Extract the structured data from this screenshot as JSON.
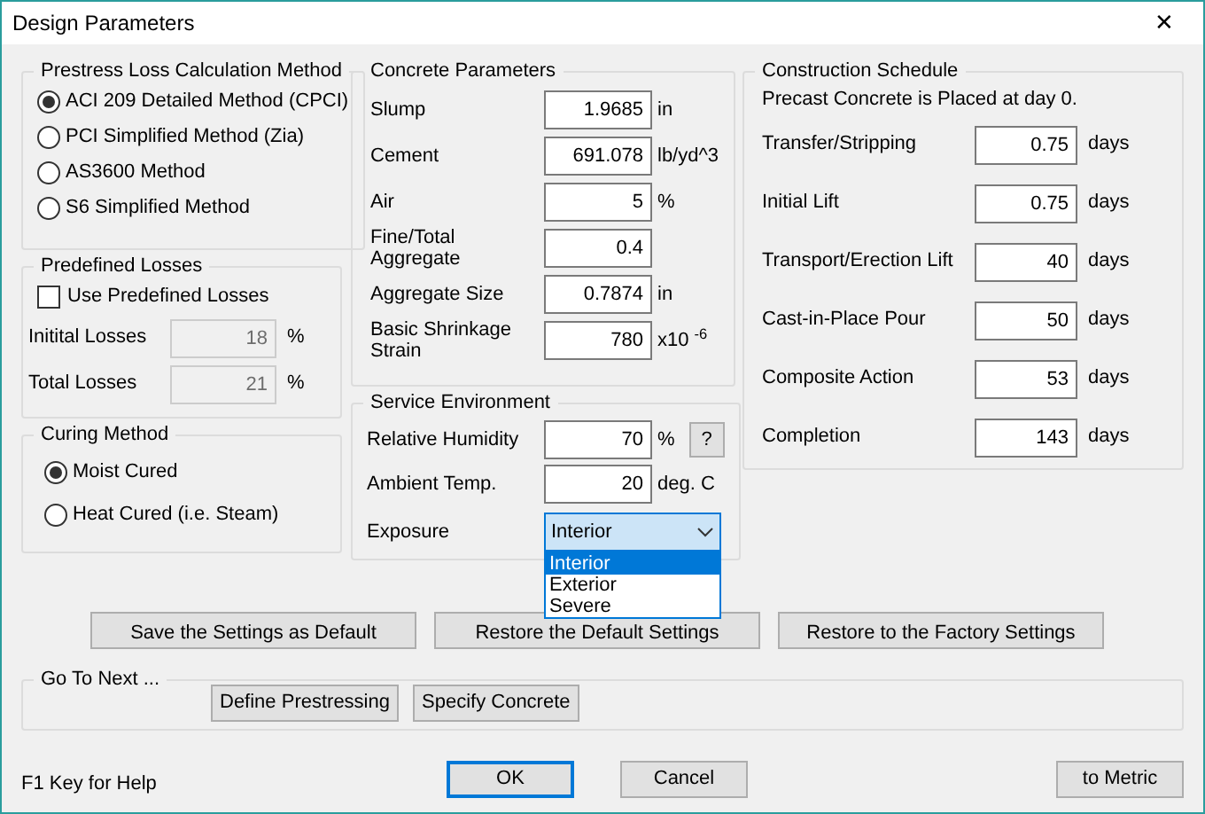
{
  "window": {
    "title": "Design Parameters",
    "close": "✕"
  },
  "loss_method": {
    "title": "Prestress Loss Calculation Method",
    "options": [
      {
        "label": "ACI 209 Detailed Method (CPCI)",
        "selected": true
      },
      {
        "label": "PCI Simplified Method (Zia)",
        "selected": false
      },
      {
        "label": "AS3600 Method",
        "selected": false
      },
      {
        "label": "S6 Simplified Method",
        "selected": false
      }
    ]
  },
  "predefined_losses": {
    "title": "Predefined Losses",
    "checkbox": {
      "label": "Use Predefined Losses",
      "checked": false
    },
    "fields": [
      {
        "label": "Initital Losses",
        "value": "18",
        "unit": "%",
        "disabled": true
      },
      {
        "label": "Total Losses",
        "value": "21",
        "unit": "%",
        "disabled": true
      }
    ]
  },
  "curing_method": {
    "title": "Curing Method",
    "options": [
      {
        "label": "Moist Cured",
        "selected": true
      },
      {
        "label": "Heat Cured (i.e. Steam)",
        "selected": false
      }
    ]
  },
  "concrete_parameters": {
    "title": "Concrete Parameters",
    "fields": [
      {
        "label": "Slump",
        "value": "1.9685",
        "unit": "in"
      },
      {
        "label": "Cement",
        "value": "691.078",
        "unit": "lb/yd^3"
      },
      {
        "label": "Air",
        "value": "5",
        "unit": "%"
      },
      {
        "label": "Fine/Total Aggregate",
        "value": "0.4"
      },
      {
        "label": "Aggregate Size",
        "value": "0.7874",
        "unit": "in"
      },
      {
        "label": "Basic Shrinkage Strain",
        "value": "780",
        "unit": "x10 $^{-6}$"
      }
    ]
  },
  "service_environment": {
    "title": "Service Environment",
    "fields": [
      {
        "label": "Relative Humidity",
        "value": "70",
        "unit": "%",
        "help": "?"
      },
      {
        "label": "Ambient Temp.",
        "value": "20",
        "unit": "deg. C"
      }
    ],
    "exposure": {
      "label": "Exposure",
      "value": "Interior",
      "expanded": true,
      "options": [
        {
          "label": "Interior",
          "selected": true
        },
        {
          "label": "Exterior",
          "selected": false
        },
        {
          "label": "Severe",
          "selected": false
        }
      ]
    }
  },
  "construction_schedule": {
    "title": "Construction Schedule",
    "note": "Precast Concrete is Placed at day 0.",
    "fields": [
      {
        "label": "Transfer/Stripping",
        "value": "0.75",
        "unit": "days"
      },
      {
        "label": "Initial Lift",
        "value": "0.75",
        "unit": "days"
      },
      {
        "label": "Transport/Erection Lift",
        "value": "40",
        "unit": "days"
      },
      {
        "label": "Cast-in-Place Pour",
        "value": "50",
        "unit": "days"
      },
      {
        "label": "Composite Action",
        "value": "53",
        "unit": "days"
      },
      {
        "label": "Completion",
        "value": "143",
        "unit": "days"
      }
    ]
  },
  "settings_buttons": [
    "Save the Settings as Default",
    "Restore the Default Settings",
    "Restore to the Factory Settings"
  ],
  "go_to_next": {
    "title": "Go To Next ...",
    "buttons": [
      "Define Prestressing",
      "Specify Concrete"
    ]
  },
  "help_text": "F1 Key for Help",
  "footer_buttons": [
    {
      "label": "OK",
      "default": true
    },
    {
      "label": "Cancel",
      "default": false
    },
    {
      "label": "to Metric",
      "default": false
    }
  ]
}
